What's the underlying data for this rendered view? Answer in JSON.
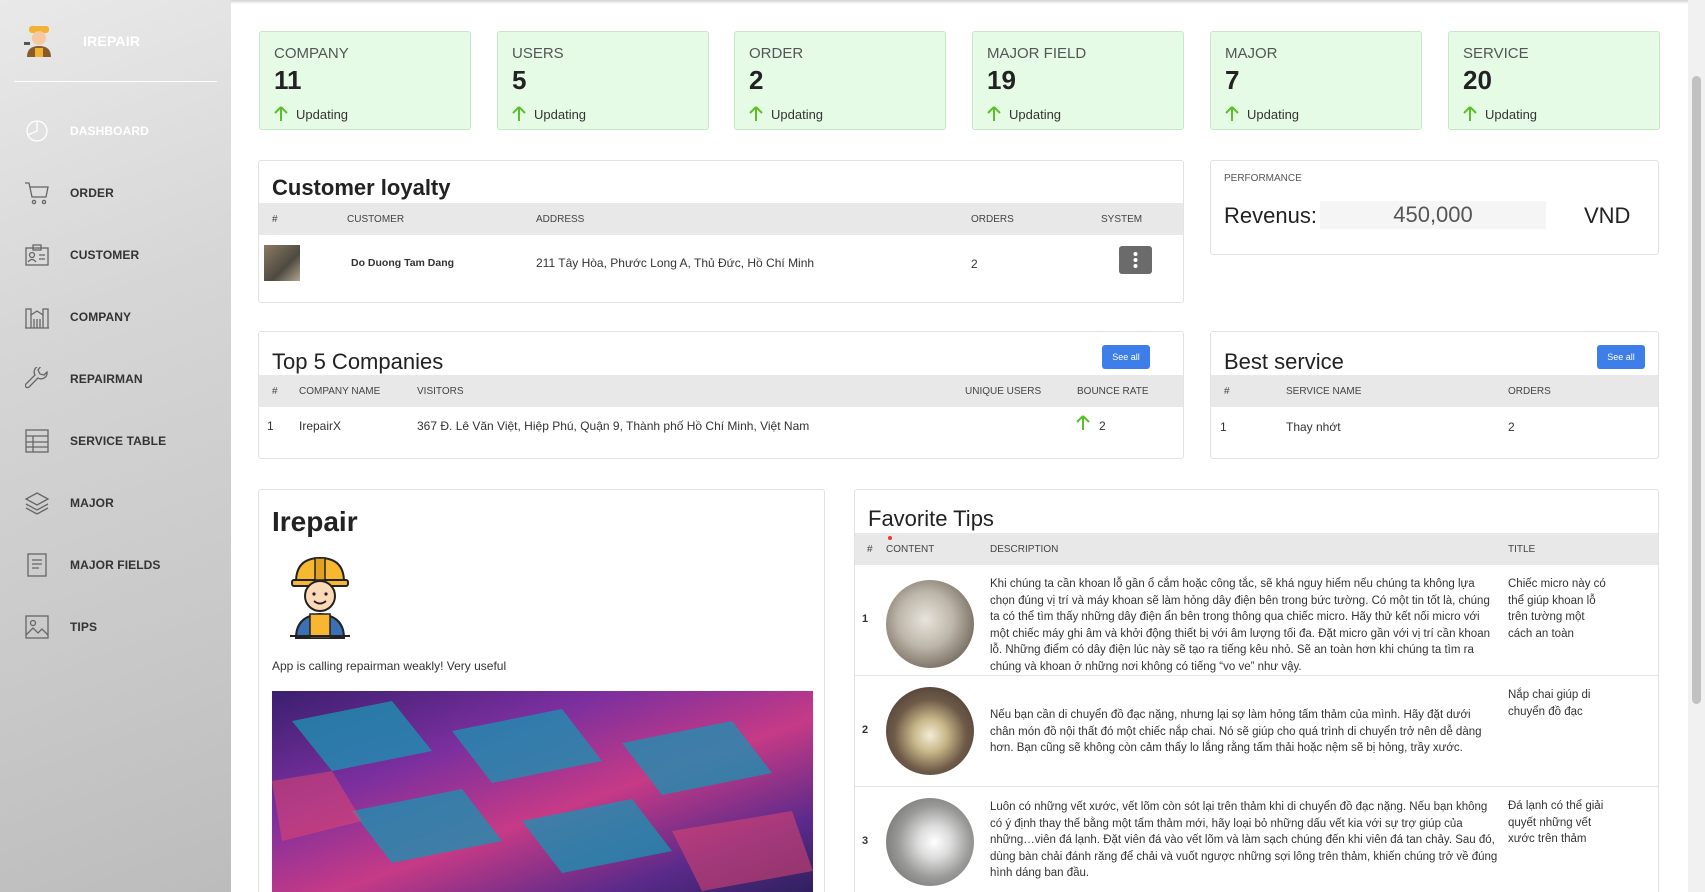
{
  "brand": {
    "name": "IREPAIR"
  },
  "sidebar": {
    "items": [
      {
        "label": "DASHBOARD",
        "icon": "dashboard-icon"
      },
      {
        "label": "ORDER",
        "icon": "cart-icon"
      },
      {
        "label": "CUSTOMER",
        "icon": "id-card-icon"
      },
      {
        "label": "COMPANY",
        "icon": "building-icon"
      },
      {
        "label": "REPAIRMAN",
        "icon": "wrench-icon"
      },
      {
        "label": "SERVICE TABLE",
        "icon": "table-icon"
      },
      {
        "label": "MAJOR",
        "icon": "layers-icon"
      },
      {
        "label": "MAJOR FIELDS",
        "icon": "document-icon"
      },
      {
        "label": "TIPS",
        "icon": "image-icon"
      }
    ]
  },
  "stats": [
    {
      "label": "COMPANY",
      "value": "11",
      "status": "Updating"
    },
    {
      "label": "USERS",
      "value": "5",
      "status": "Updating"
    },
    {
      "label": "ORDER",
      "value": "2",
      "status": "Updating"
    },
    {
      "label": "MAJOR FIELD",
      "value": "19",
      "status": "Updating"
    },
    {
      "label": "MAJOR",
      "value": "7",
      "status": "Updating"
    },
    {
      "label": "SERVICE",
      "value": "20",
      "status": "Updating"
    }
  ],
  "loyalty": {
    "title": "Customer loyalty",
    "headers": [
      "#",
      "CUSTOMER",
      "ADDRESS",
      "ORDERS",
      "SYSTEM"
    ],
    "rows": [
      {
        "customer": "Do Duong Tam Dang",
        "address": "211 Tây Hòa, Phước Long A, Thủ Đức, Hồ Chí Minh",
        "orders": "2"
      }
    ]
  },
  "performance": {
    "label": "PERFORMANCE",
    "revenue_label": "Revenus:",
    "revenue_value": "450,000",
    "currency": "VND"
  },
  "companies": {
    "title": "Top 5 Companies",
    "see_all": "See all",
    "headers": [
      "#",
      "COMPANY NAME",
      "VISITORS",
      "UNIQUE USERS",
      "BOUNCE RATE"
    ],
    "rows": [
      {
        "num": "1",
        "name": "IrepairX",
        "visitors": "367 Đ. Lê Văn Việt, Hiệp Phú, Quận 9, Thành phố Hồ Chí Minh, Việt Nam",
        "bounce": "2"
      }
    ]
  },
  "best_service": {
    "title": "Best service",
    "see_all": "See all",
    "headers": [
      "#",
      "SERVICE NAME",
      "ORDERS"
    ],
    "rows": [
      {
        "num": "1",
        "name": "Thay nhớt",
        "orders": "2"
      }
    ]
  },
  "about": {
    "title": "Irepair",
    "caption": "App is calling repairman weakly! Very useful"
  },
  "tips": {
    "title": "Favorite Tips",
    "headers": [
      "#",
      "CONTENT",
      "DESCRIPTION",
      "TITLE"
    ],
    "rows": [
      {
        "num": "1",
        "description": "Khi chúng ta cần khoan lỗ gần ổ cắm hoặc công tắc, sẽ khá nguy hiểm nếu chúng ta không lựa chọn đúng vị trí và máy khoan sẽ làm hỏng dây điện bên trong bức tường. Có một tin tốt là, chúng ta có thể tìm thấy những dây điện ẩn bên trong thông qua chiếc micro. Hãy thử kết nối micro với một chiếc máy ghi âm và khởi động thiết bị với âm lượng tối đa. Đặt micro gần với vị trí cần khoan lỗ. Những điểm có dây điện lúc này sẽ tạo ra tiếng kêu nhỏ. Sẽ an toàn hơn khi chúng ta tìm ra chúng và khoan ở những nơi không có tiếng “vo ve” như vậy.",
        "title": "Chiếc micro này có thể giúp khoan lỗ trên tường một cách an toàn"
      },
      {
        "num": "2",
        "description": "Nếu bạn cần di chuyển đồ đạc nặng, nhưng lại sợ làm hỏng tấm thảm của mình. Hãy đặt dưới chân món đồ nội thất đó một chiếc nắp chai. Nó sẽ giúp cho quá trình di chuyển trở nên dễ dàng hơn. Bạn cũng sẽ không còn cảm thấy lo lắng rằng tấm thải hoặc nệm sẽ bị hỏng, trầy xước.",
        "title": "Nắp chai giúp di chuyển đồ đạc"
      },
      {
        "num": "3",
        "description": "Luôn có những vết xước, vết lõm còn sót lại trên thảm khi di chuyển đồ đạc nặng. Nếu bạn không có ý định thay thế bằng một tấm thảm mới, hãy loại bỏ những dấu vết kia với sự trợ giúp của những…viên đá lạnh. Đặt viên đá vào vết lõm và làm sạch chúng đến khi viên đá tan chảy. Sau đó, dùng bàn chải đánh răng để chải và vuốt ngược những sợi lông trên thảm, khiến chúng trở về đúng hình dáng ban đầu.",
        "title": "Đá lạnh có thể giải quyết những vết xước trên thảm"
      }
    ]
  },
  "colors": {
    "accent": "#3d7ee8",
    "stat_bg": "#e6fbe6",
    "up_arrow": "#5bbf2a"
  }
}
